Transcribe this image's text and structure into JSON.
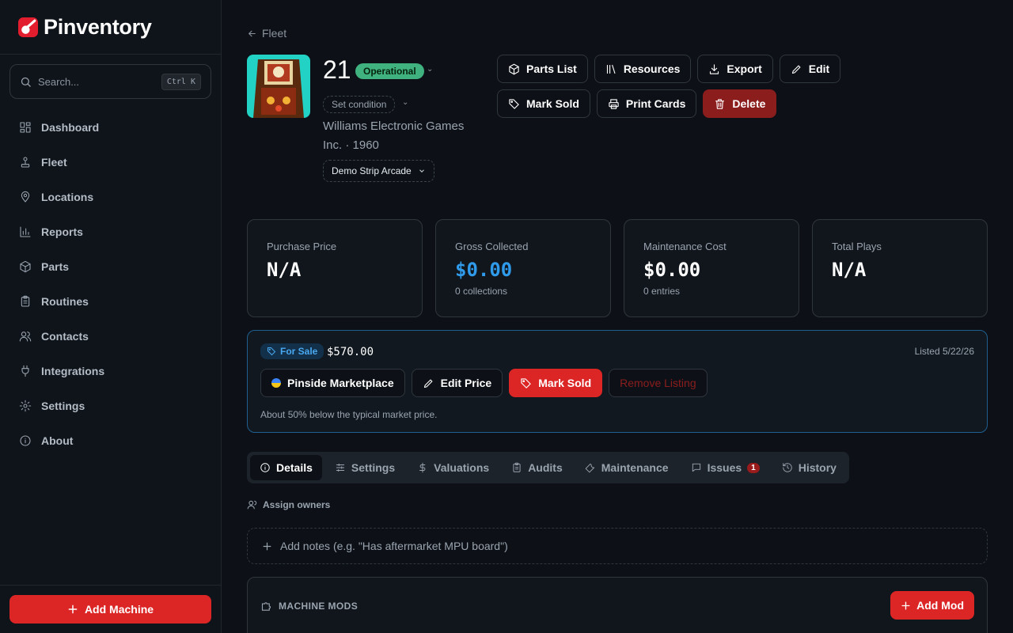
{
  "brand": {
    "name": "Pinventory"
  },
  "search": {
    "placeholder": "Search...",
    "shortcut": "Ctrl K"
  },
  "nav": [
    {
      "label": "Dashboard",
      "icon": "grid-icon"
    },
    {
      "label": "Fleet",
      "icon": "joystick-icon"
    },
    {
      "label": "Locations",
      "icon": "map-pin-icon"
    },
    {
      "label": "Reports",
      "icon": "bar-chart-icon"
    },
    {
      "label": "Parts",
      "icon": "package-icon"
    },
    {
      "label": "Routines",
      "icon": "clipboard-icon"
    },
    {
      "label": "Contacts",
      "icon": "users-icon"
    },
    {
      "label": "Integrations",
      "icon": "plug-icon"
    },
    {
      "label": "Settings",
      "icon": "gear-icon"
    },
    {
      "label": "About",
      "icon": "info-icon"
    }
  ],
  "sidebar_footer": {
    "add_machine": "Add Machine"
  },
  "header": {
    "back_label": "Fleet",
    "machine_name": "21",
    "status": "Operational",
    "condition": "Set condition",
    "manufacturer_line1": "Williams Electronic Games",
    "manufacturer_line2": "Inc. · 1960",
    "location": "Demo Strip Arcade"
  },
  "actions": {
    "parts_list": "Parts List",
    "resources": "Resources",
    "export": "Export",
    "edit": "Edit",
    "mark_sold": "Mark Sold",
    "print_cards": "Print Cards",
    "delete": "Delete"
  },
  "stats": [
    {
      "label": "Purchase Price",
      "value": "N/A",
      "sub": ""
    },
    {
      "label": "Gross Collected",
      "value": "$0.00",
      "sub": "0 collections"
    },
    {
      "label": "Maintenance Cost",
      "value": "$0.00",
      "sub": "0 entries"
    },
    {
      "label": "Total Plays",
      "value": "N/A",
      "sub": ""
    }
  ],
  "sale": {
    "badge": "For Sale",
    "price": "$570.00",
    "listed": "Listed 5/22/26",
    "marketplace_button": "Pinside Marketplace",
    "edit_price_button": "Edit Price",
    "mark_sold_button": "Mark Sold",
    "remove_button": "Remove Listing",
    "note": "About 50% below the typical market price."
  },
  "tabs": [
    {
      "label": "Details",
      "active": true
    },
    {
      "label": "Settings"
    },
    {
      "label": "Valuations"
    },
    {
      "label": "Audits"
    },
    {
      "label": "Maintenance"
    },
    {
      "label": "Issues",
      "badge": "1"
    },
    {
      "label": "History"
    }
  ],
  "owners": {
    "label": "Assign owners"
  },
  "notes": {
    "placeholder": "Add notes (e.g. \"Has aftermarket MPU board\")"
  },
  "mods": {
    "title": "MACHINE MODS",
    "add_button": "Add Mod"
  },
  "colors": {
    "accent_red": "#dc2626",
    "status_green": "#3fb27f",
    "link_blue": "#2f9bea"
  }
}
